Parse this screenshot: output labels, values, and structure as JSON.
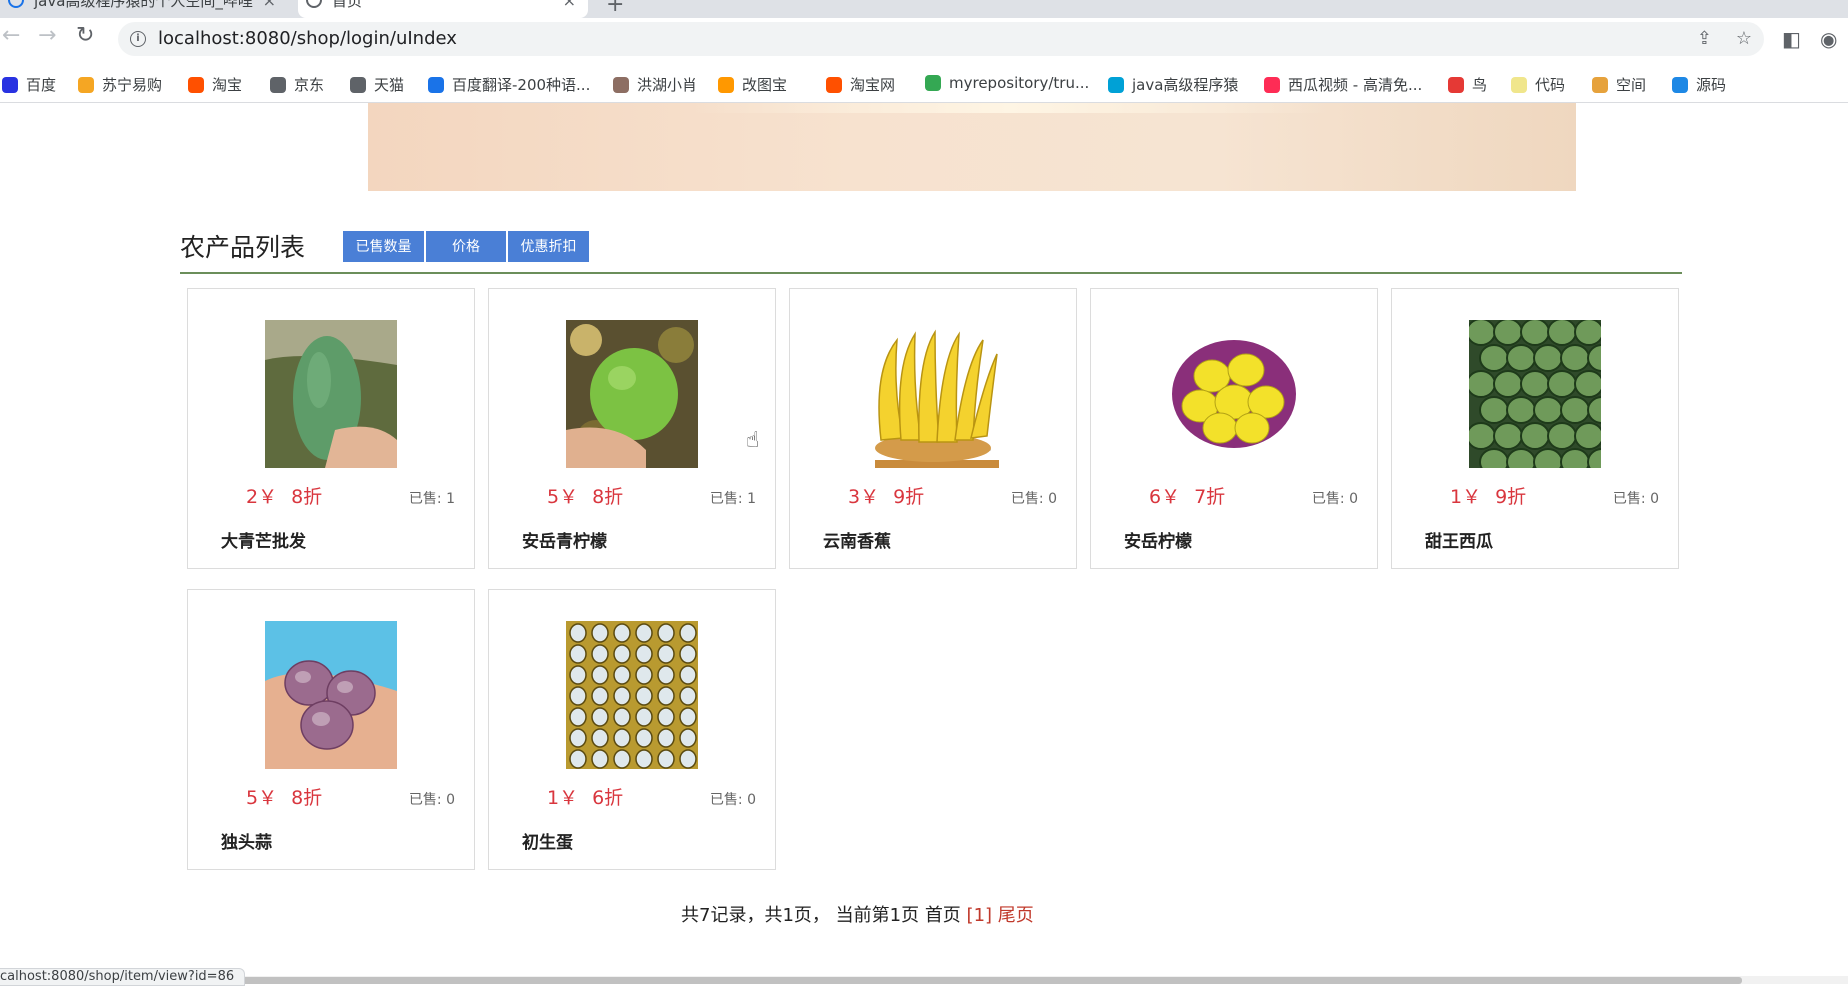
{
  "browser": {
    "tabs": [
      {
        "label": "java高级程序猿的个人空间_哔哩",
        "state": "inactive"
      },
      {
        "label": "首页",
        "state": "active"
      }
    ],
    "new_tab": "+",
    "url": "localhost:8080/shop/login/uIndex",
    "status_url": "calhost:8080/shop/item/view?id=86"
  },
  "bookmarks": [
    {
      "label": "百度",
      "icon": "baidu-icon",
      "color": "#2932e1"
    },
    {
      "label": "苏宁易购",
      "icon": "suning-icon",
      "color": "#f5a623"
    },
    {
      "label": "淘宝",
      "icon": "taobao-icon",
      "color": "#ff5000"
    },
    {
      "label": "京东",
      "icon": "globe-icon",
      "color": "#5f6368"
    },
    {
      "label": "天猫",
      "icon": "globe-icon",
      "color": "#5f6368"
    },
    {
      "label": "百度翻译-200种语...",
      "icon": "translate-icon",
      "color": "#1a73e8"
    },
    {
      "label": "洪湖小肖",
      "icon": "hand-icon",
      "color": "#8d6e63"
    },
    {
      "label": "改图宝",
      "icon": "folder-icon",
      "color": "#ff9800"
    },
    {
      "label": "淘宝网",
      "icon": "taobao-icon",
      "color": "#ff5000"
    },
    {
      "label": "myrepository/tru...",
      "icon": "chrome-icon",
      "color": "#34a853"
    },
    {
      "label": "java高级程序猿",
      "icon": "bilibili-icon",
      "color": "#00a1d6"
    },
    {
      "label": "西瓜视频 - 高清免...",
      "icon": "xigua-icon",
      "color": "#fe2c55"
    },
    {
      "label": "鸟",
      "icon": "bird-icon",
      "color": "#e53935"
    },
    {
      "label": "代码",
      "icon": "code-icon",
      "color": "#f0e68c"
    },
    {
      "label": "空间",
      "icon": "qzone-icon",
      "color": "#e6a23c"
    },
    {
      "label": "源码",
      "icon": "fish-icon",
      "color": "#1e88e5"
    }
  ],
  "section": {
    "title": "农产品列表",
    "sort_buttons": [
      "已售数量",
      "价格",
      "优惠折扣"
    ]
  },
  "products": [
    {
      "name": "大青芒批发",
      "price": "2￥",
      "discount": "8折",
      "sold": "已售: 1",
      "image": "green-mango"
    },
    {
      "name": "安岳青柠檬",
      "price": "5￥",
      "discount": "8折",
      "sold": "已售: 1",
      "image": "green-lemon"
    },
    {
      "name": "云南香蕉",
      "price": "3￥",
      "discount": "9折",
      "sold": "已售: 0",
      "image": "banana"
    },
    {
      "name": "安岳柠檬",
      "price": "6￥",
      "discount": "7折",
      "sold": "已售: 0",
      "image": "yellow-lemon"
    },
    {
      "name": "甜王西瓜",
      "price": "1￥",
      "discount": "9折",
      "sold": "已售: 0",
      "image": "watermelon"
    },
    {
      "name": "独头蒜",
      "price": "5￥",
      "discount": "8折",
      "sold": "已售: 0",
      "image": "garlic"
    },
    {
      "name": "初生蛋",
      "price": "1￥",
      "discount": "6折",
      "sold": "已售: 0",
      "image": "eggs"
    }
  ],
  "pagination": {
    "summary": "共7记录，共1页， 当前第1页",
    "first": "首页",
    "current": "[1]",
    "last": "尾页"
  },
  "colors": {
    "accent_button": "#4a7fd6",
    "price_red": "#d9363e",
    "section_rule": "#6b8e5a"
  }
}
